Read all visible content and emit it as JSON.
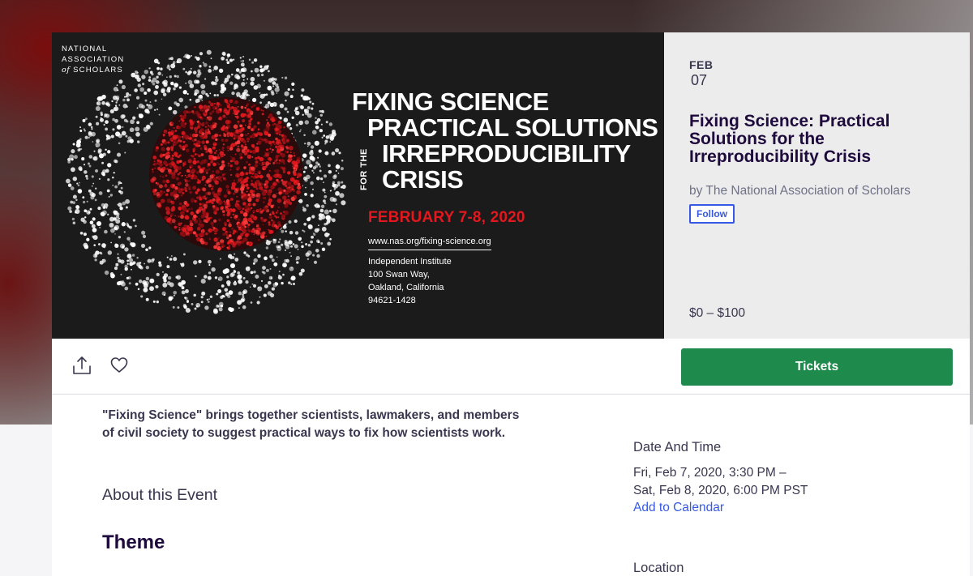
{
  "hero": {
    "logo": {
      "line1": "NATIONAL",
      "line2": "ASSOCIATION",
      "of": "of",
      "line3": "SCHOLARS"
    },
    "title_lines": [
      "FIXING SCIENCE",
      "PRACTICAL SOLUTIONS",
      "IRREPRODUCIBILITY",
      "CRISIS"
    ],
    "for_the": "FOR THE",
    "dates": "FEBRUARY 7-8, 2020",
    "url": "www.nas.org/fixing-science.org",
    "address_lines": [
      "Independent Institute",
      "100 Swan Way,",
      "Oakland, California",
      "94621-1428"
    ],
    "colors": {
      "background": "#1b1b1b",
      "accent": "#e3181f",
      "text": "#ffffff"
    }
  },
  "summary": {
    "month": "FEB",
    "day": "07",
    "title": "Fixing Science: Practical Solutions for the Irreproducibility Crisis",
    "organizer": "by The National Association of Scholars",
    "follow_label": "Follow",
    "price": "$0 – $100"
  },
  "actions": {
    "share_icon": "share-icon",
    "like_icon": "heart-icon",
    "tickets_label": "Tickets",
    "tickets_color": "#1e8a4c"
  },
  "content": {
    "description": "\"Fixing Science\" brings together scientists, lawmakers, and members of civil society to suggest practical ways to fix how scientists work.",
    "about_heading": "About this Event",
    "theme_heading": "Theme"
  },
  "sidebar": {
    "date_heading": "Date And Time",
    "date_line1": "Fri, Feb 7, 2020, 3:30 PM –",
    "date_line2": "Sat, Feb 8, 2020, 6:00 PM PST",
    "calendar_link": "Add to Calendar",
    "location_heading": "Location"
  }
}
